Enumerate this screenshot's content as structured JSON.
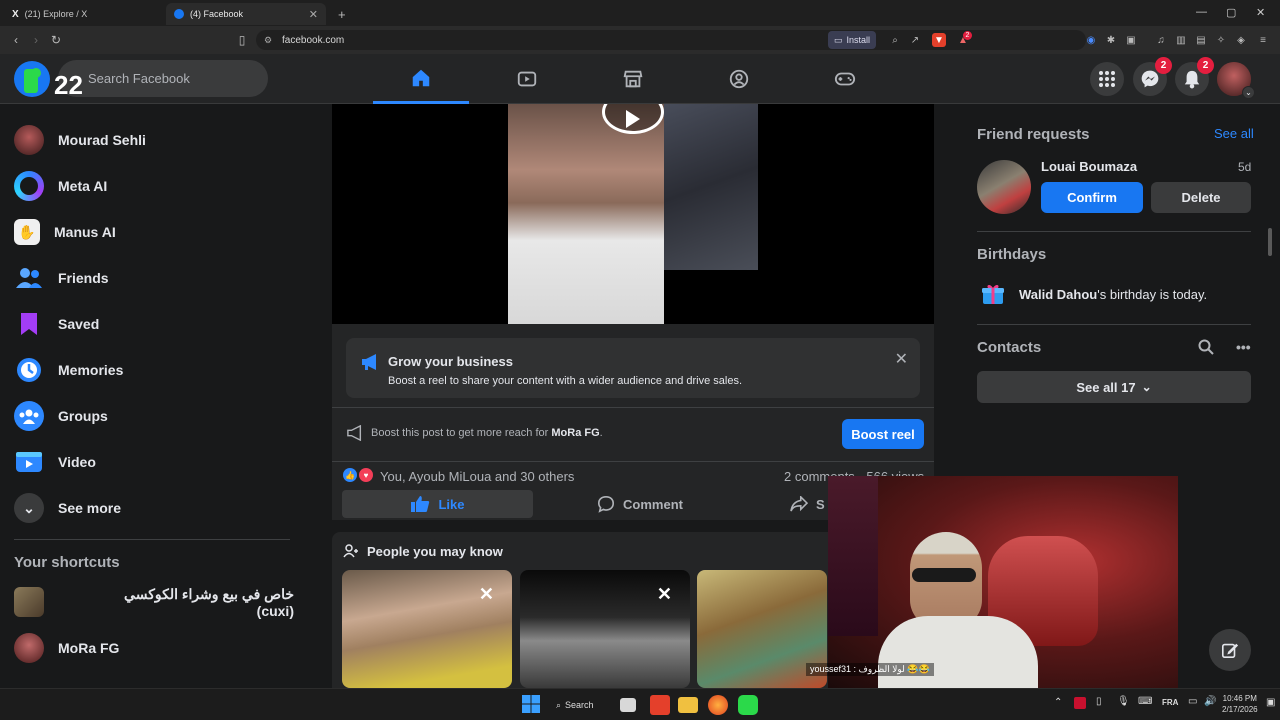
{
  "browser": {
    "tabs": [
      {
        "label": "(21) Explore / X"
      },
      {
        "label": "(4) Facebook"
      }
    ],
    "url": "facebook.com",
    "install_label": "Install",
    "ext_badge": "2"
  },
  "header": {
    "badge_count": "22",
    "search_placeholder": "Search Facebook",
    "messenger_badge": "2",
    "notifications_badge": "2"
  },
  "sidebar": {
    "items": [
      {
        "label": "Mourad Sehli"
      },
      {
        "label": "Meta AI"
      },
      {
        "label": "Manus AI"
      },
      {
        "label": "Friends"
      },
      {
        "label": "Saved"
      },
      {
        "label": "Memories"
      },
      {
        "label": "Groups"
      },
      {
        "label": "Video"
      },
      {
        "label": "See more"
      }
    ],
    "shortcuts_title": "Your shortcuts",
    "shortcuts": [
      {
        "label": "خاص في بيع وشراء الكوكسي (cuxi)"
      },
      {
        "label": "MoRa FG"
      }
    ]
  },
  "post": {
    "grow_title": "Grow your business",
    "grow_desc": "Boost a reel to share your content with a wider audience and drive sales.",
    "boost_text_prefix": "Boost this post to get more reach for ",
    "boost_text_page": "MoRa FG",
    "boost_text_suffix": ".",
    "boost_button": "Boost reel",
    "reactions_text": "You, Ayoub MiLoua and 30 others",
    "stats_text": "2 comments · 566 views",
    "like_label": "Like",
    "comment_label": "Comment",
    "share_label": "S"
  },
  "pymk": {
    "title": "People you may know"
  },
  "right": {
    "fr_title": "Friend requests",
    "fr_seeall": "See all",
    "fr_name": "Louai Boumaza",
    "fr_age": "5d",
    "fr_confirm": "Confirm",
    "fr_delete": "Delete",
    "bd_title": "Birthdays",
    "bd_name": "Walid Dahou",
    "bd_suffix": "'s birthday is today.",
    "ct_title": "Contacts",
    "ct_seeall": "See all 17"
  },
  "overlay": {
    "chat_text": "youssef31 : لولا الظروف 😂😂"
  },
  "taskbar": {
    "search_label": "Search",
    "lang": "FRA",
    "time": "10:46 PM",
    "date": "2/17/2026"
  },
  "colors": {
    "fb_blue": "#1877f2",
    "accent_blue": "#2d88ff",
    "bg": "#18191a",
    "card": "#242526",
    "badge_red": "#e41e3f"
  }
}
